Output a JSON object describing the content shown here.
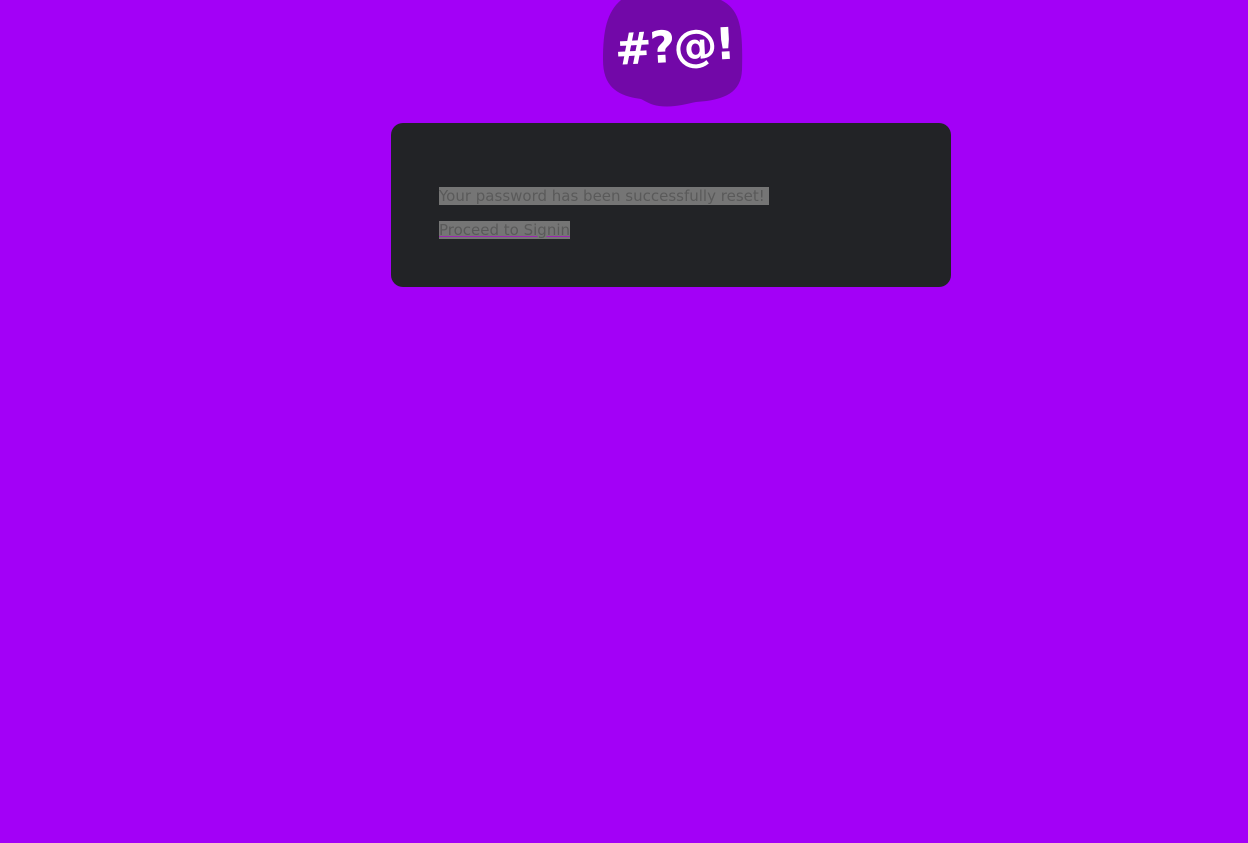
{
  "logo": {
    "glyphs": "#?@!",
    "icon": "speech-bubble-icon",
    "bubble_color": "#7208a8"
  },
  "colors": {
    "background": "#a300f7",
    "card": "#222326",
    "text_highlight": "#757575",
    "text": "#5a5a5a"
  },
  "card": {
    "message": "Your password has been successfully reset!",
    "link_label": "Proceed to Signin"
  }
}
